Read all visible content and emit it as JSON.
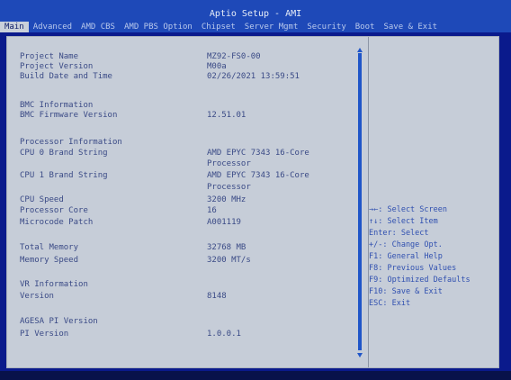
{
  "app": {
    "title": "Aptio Setup - AMI"
  },
  "tabs": [
    "Main",
    "Advanced",
    "AMD CBS",
    "AMD PBS Option",
    "Chipset",
    "Server Mgmt",
    "Security",
    "Boot",
    "Save & Exit"
  ],
  "rows": [
    {
      "label": "Project Name",
      "value": "MZ92-FS0-00"
    },
    {
      "label": "Project Version",
      "value": "M00a"
    },
    {
      "label": "Build Date and Time",
      "value": "02/26/2021 13:59:51"
    },
    {
      "label": "BMC Information",
      "value": ""
    },
    {
      "label": "BMC Firmware Version",
      "value": "12.51.01"
    },
    {
      "label": "Processor Information",
      "value": ""
    },
    {
      "label": "CPU 0 Brand String",
      "value": "AMD EPYC 7343 16-Core"
    },
    {
      "label": "",
      "value": "Processor"
    },
    {
      "label": "CPU 1 Brand String",
      "value": "AMD EPYC 7343 16-Core"
    },
    {
      "label": "",
      "value": "Processor"
    },
    {
      "label": "CPU Speed",
      "value": "3200 MHz"
    },
    {
      "label": "Processor Core",
      "value": "16"
    },
    {
      "label": "Microcode Patch",
      "value": "A001119"
    },
    {
      "label": "Total Memory",
      "value": "32768 MB"
    },
    {
      "label": "Memory Speed",
      "value": "3200 MT/s"
    },
    {
      "label": "VR Information",
      "value": ""
    },
    {
      "label": "Version",
      "value": "8148"
    },
    {
      "label": "AGESA PI Version",
      "value": ""
    },
    {
      "label": "PI Version",
      "value": "1.0.0.1"
    }
  ],
  "help": [
    "→←: Select Screen",
    "↑↓: Select Item",
    "Enter: Select",
    "+/-: Change Opt.",
    "F1: General Help",
    "F8: Previous Values",
    "F9: Optimized Defaults",
    "F10: Save & Exit",
    "ESC: Exit"
  ],
  "colors": {
    "accent": "#1e49b8",
    "panel": "#c6cdd8",
    "text": "#3a4a86",
    "help": "#3050b0"
  }
}
